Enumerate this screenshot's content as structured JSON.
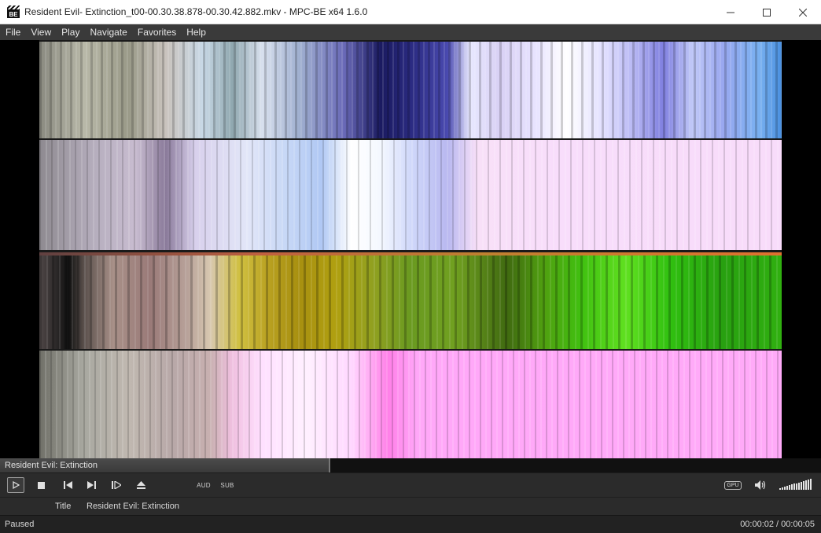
{
  "window": {
    "title": "Resident Evil- Extinction_t00-00.30.38.878-00.30.42.882.mkv - MPC-BE x64 1.6.0",
    "app_icon_label": "BE"
  },
  "menu": {
    "items": [
      "File",
      "View",
      "Play",
      "Navigate",
      "Favorites",
      "Help"
    ]
  },
  "seekbar": {
    "title": "Resident Evil: Extinction",
    "progress": 0.4
  },
  "controls": {
    "audio_label": "AUD",
    "subtitle_label": "SUB",
    "gpu_label": "GPU",
    "volume_level": 1.0
  },
  "info": {
    "label": "Title",
    "value": "Resident Evil: Extinction"
  },
  "status": {
    "state": "Paused",
    "time": "00:00:02 / 00:00:05"
  },
  "colors": {
    "menubar": "#3a3a3a",
    "controls_bg": "#2b2b2b",
    "text": "#d8d8d8"
  }
}
